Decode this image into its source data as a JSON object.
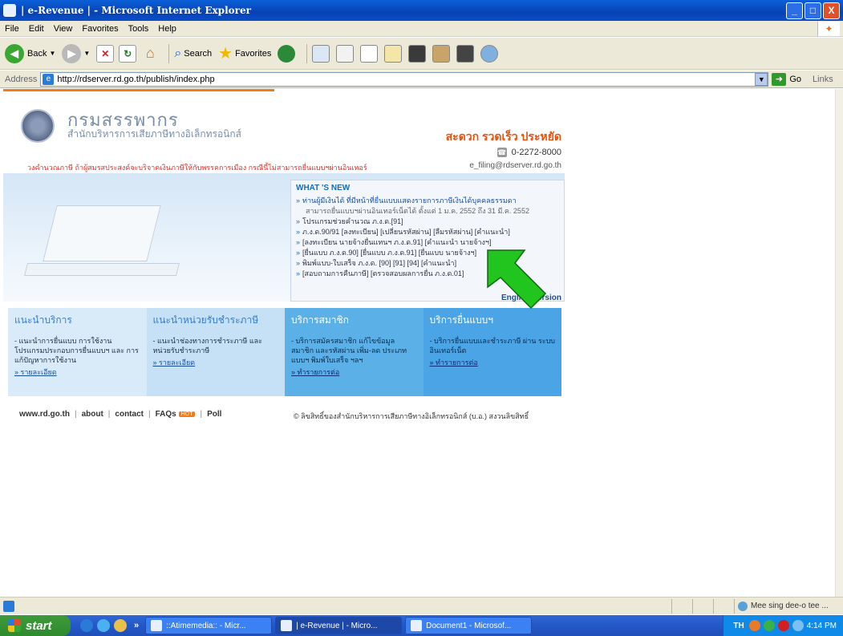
{
  "window": {
    "title": "| e-Revenue | - Microsoft Internet Explorer",
    "controls": [
      "_",
      "□",
      "X"
    ]
  },
  "menu": [
    "File",
    "Edit",
    "View",
    "Favorites",
    "Tools",
    "Help"
  ],
  "toolbar": {
    "back_label": "Back",
    "search_label": "Search",
    "favorites_label": "Favorites"
  },
  "address": {
    "label": "Address",
    "url": "http://rdserver.rd.go.th/publish/index.php",
    "go_label": "Go",
    "links_label": "Links"
  },
  "page": {
    "dept_name": "กรมสรรพากร",
    "dept_sub": "สำนักบริหารการเสียภาษีทางอิเล็กทรอนิกส์",
    "slogan": "สะดวก รวดเร็ว ประหยัด",
    "phone": "0-2272-8000",
    "email": "e_filing@rdserver.rd.go.th",
    "warning": "วงคำนวณภาษี ถ้าผู้สมรสประสงค์จะบริจาคเงินภาษีให้กับพรรคการเมือง กรณีนี้ไม่สามารถยื่นแบบฯผ่านอินเทอร์",
    "news_title": "WHAT 'S NEW",
    "news_first": "ท่านผู้มีเงินได้ ที่มีหน้าที่ยื่นแบบแสดงรายการภาษีเงินได้บุคคลธรรมดา",
    "news_first_cont": "สามารถยื่นแบบฯผ่านอินเทอร์เน็ตได้ ตั้งแต่ 1 ม.ค. 2552 ถึง 31 มี.ค. 2552",
    "news_items": [
      "โปรแกรมช่วยคำนวณ ภ.ง.ด.[91]",
      "ภ.ง.ด.90/91 [ลงทะเบียน] [เปลี่ยนรหัสผ่าน] [ลืมรหัสผ่าน] [คำแนะนำ]",
      "[ลงทะเบียน นายจ้างยื่นแทนฯ ภ.ง.ด.91] [คำแนะนำ นายจ้างฯ]",
      "[ยื่นแบบ ภ.ง.ด.90] [ยื่นแบบ ภ.ง.ด.91] [ยื่นแบบ นายจ้างฯ]",
      "พิมพ์แบบ-ใบเสร็จ ภ.ง.ด. [90] [91] [94] [คำแนะนำ]",
      "[สอบถามการคืนภาษี] [ตรวจสอบผลการยื่น ภ.ง.ด.01]"
    ],
    "english_link": "English Version",
    "services": [
      {
        "title": "แนะนำบริการ",
        "text": "- แนะนำการยื่นแบบ การใช้งาน โปรแกรมประกอบการยื่นแบบฯ และ การแก้ปัญหาการใช้งาน",
        "link": "รายละเอียด"
      },
      {
        "title": "แนะนำหน่วยรับชำระภาษี",
        "text": "- แนะนำช่องทางการชำระภาษี และ หน่วยรับชำระภาษี",
        "link": "รายละเอียด"
      },
      {
        "title": "บริการสมาชิก",
        "text": "- บริการสมัครสมาชิก แก้ไขข้อมูล สมาชิก และรหัสผ่าน เพิ่ม-ลด ประเภทแบบฯ พิมพ์ใบเสร็จ ฯลฯ",
        "link": "ทำรายการต่อ"
      },
      {
        "title": "บริการยื่นแบบฯ",
        "text": "- บริการยื่นแบบและชำระภาษี ผ่าน ระบบอินเทอร์เน็ต",
        "link": "ทำรายการต่อ"
      }
    ],
    "footer_links": [
      "www.rd.go.th",
      "about",
      "contact",
      "FAQs",
      "Poll"
    ],
    "hot_badge": "HOT",
    "copyright": "© ลิขสิทธิ์ของสำนักบริหารการเสียภาษีทางอิเล็กทรอนิกส์ (บ.อ.) สงวนลิขสิทธิ์"
  },
  "status": {
    "zone_text": "Mee sing dee-o tee ..."
  },
  "taskbar": {
    "start_label": "start",
    "tasks": [
      "::Atimemedia:: - Micr...",
      "| e-Revenue | - Micro...",
      "Document1 - Microsof..."
    ],
    "tray_lang": "TH",
    "clock": "4:14 PM"
  },
  "colors": {
    "accent_orange": "#e8520f",
    "cursor_green": "#22c41e",
    "title_blue": "#0842b4"
  }
}
